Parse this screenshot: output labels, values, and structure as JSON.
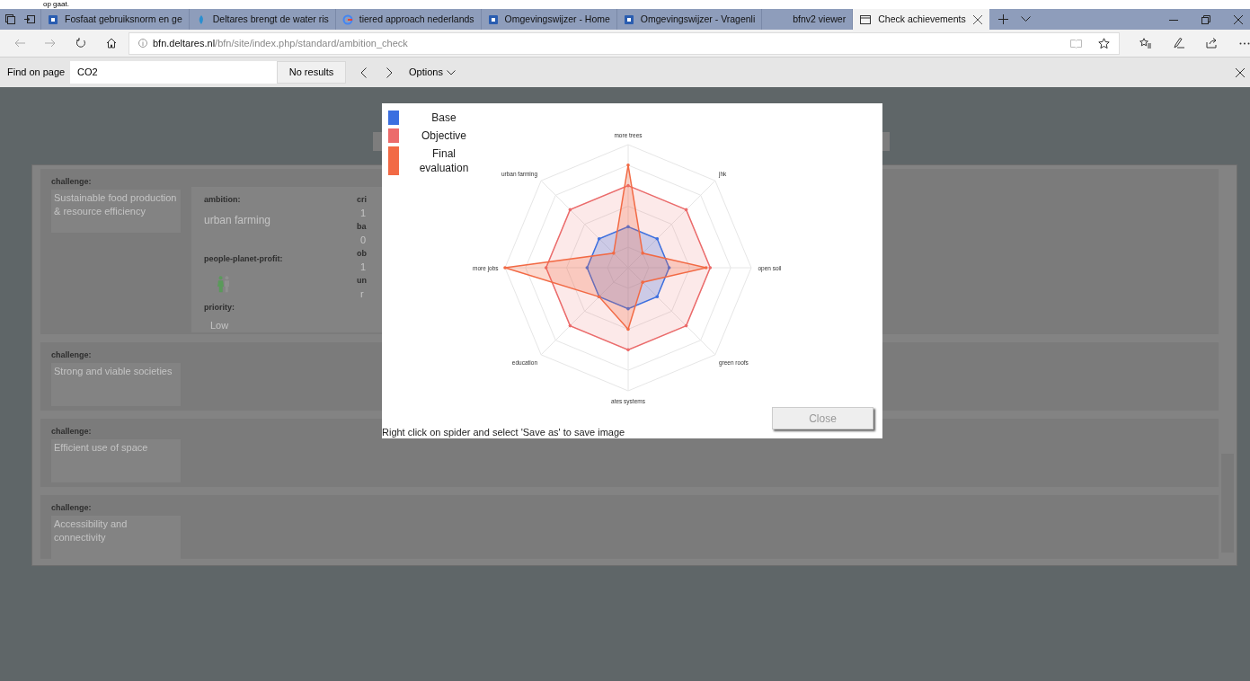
{
  "top_text": "op gaat.",
  "browser": {
    "tabs": [
      {
        "title": "Fosfaat gebruiksnorm en ge",
        "selected": false
      },
      {
        "title": "Deltares brengt de water ris",
        "selected": false
      },
      {
        "title": "tiered approach nederlands",
        "selected": false
      },
      {
        "title": "Omgevingswijzer - Home",
        "selected": false
      },
      {
        "title": "Omgevingswijzer - Vragenli",
        "selected": false
      },
      {
        "title": "bfnv2 viewer",
        "selected": false
      },
      {
        "title": "Check achievements",
        "selected": true
      }
    ],
    "address": {
      "host": "bfn.deltares.nl",
      "path": "/bfn/site/index.php/standard/ambition_check"
    },
    "find_bar": {
      "label": "Find on page",
      "value": "CO2",
      "result": "No results",
      "options": "Options"
    }
  },
  "challenges": [
    {
      "label": "challenge:",
      "text": "Sustainable food production & resource efficiency",
      "ambition": {
        "label": "ambition:",
        "value": "urban farming",
        "ppp_label": "people-planet-profit:",
        "priority_label": "priority:",
        "priority": "Low",
        "fields": [
          {
            "label": "cri",
            "value": "1"
          },
          {
            "label": "ba",
            "value": "0"
          },
          {
            "label": "ob",
            "value": "1"
          },
          {
            "label": "un",
            "value": "r"
          }
        ]
      }
    },
    {
      "label": "challenge:",
      "text": "Strong and viable societies"
    },
    {
      "label": "challenge:",
      "text": "Efficient use of space"
    },
    {
      "label": "challenge:",
      "text": "Accessibility and connectivity"
    }
  ],
  "modal": {
    "legend": [
      {
        "label": "Base",
        "color": "#3b6fe0"
      },
      {
        "label": "Objective",
        "color": "#ec6b6b"
      },
      {
        "label": "Final evaluation",
        "color": "#f26a45"
      }
    ],
    "axes": [
      "more trees",
      "jhk",
      "open soil",
      "green roofs",
      "ates systems",
      "education",
      "more jobs",
      "urban farming"
    ],
    "close": "Close",
    "hint": "Right click on spider and select 'Save as' to save image"
  }
}
